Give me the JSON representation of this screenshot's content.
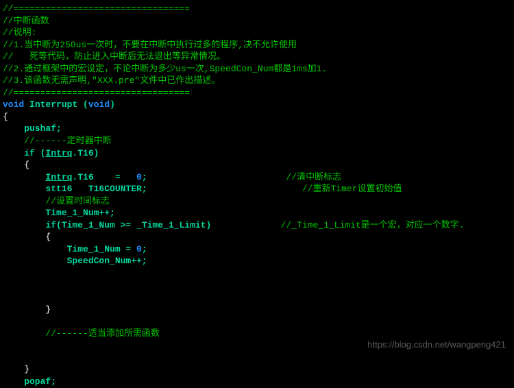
{
  "code": {
    "l1": "//=================================",
    "l2": "//中断函数",
    "l3": "//说明:",
    "l4": "//1.当中断为250us一次时，不要在中断中执行过多的程序,决不允许使用",
    "l5": "//   死等代码，防止进入中断后无法退出等异常情况。",
    "l6": "//2.通过框架中的宏设定，不论中断为多少us一次,SpeedCon_Num都是1ms加1.",
    "l7": "//3.该函数无需声明,\"XXX.pre\"文件中已作出描述。",
    "l8": "//=================================",
    "sig1": "void",
    "sig2": " Interrupt (",
    "sig3": "void",
    "sig4": ")",
    "brace_open": "{",
    "pushaf": "    pushaf;",
    "c_timer": "    //------定时器中断",
    "if1a": "    if (",
    "if1b": "Intrq",
    "if1c": ".T16)",
    "brace1": "    {",
    "l_intrq_a": "        ",
    "l_intrq_b": "Intrq",
    "l_intrq_c": ".T16    =   ",
    "l_intrq_d": "0",
    "l_intrq_e": ";",
    "c_clear": "                          //清中断标志",
    "l_stt": "        stt16   T16COUNTER;",
    "c_reset": "                             //重新Timer设置初始值",
    "c_setflag": "        //设置时间标志",
    "l_t1inc": "        Time_1_Num++;",
    "l_ifcmp": "        if(Time_1_Num >= _Time_1_Limit)",
    "c_macro": "             //_Time_1_Limit是一个宏，对应一个数字.",
    "brace2": "        {",
    "l_t1a": "            Time_1_Num = ",
    "l_t1b": "0",
    "l_t1c": ";",
    "l_spd": "            SpeedCon_Num++;",
    "brace2c": "        }",
    "c_addfn": "        //------适当添加所需函数",
    "brace1c": "    }",
    "popaf": "    popaf;"
  },
  "watermark": "https://blog.csdn.net/wangpeng421"
}
